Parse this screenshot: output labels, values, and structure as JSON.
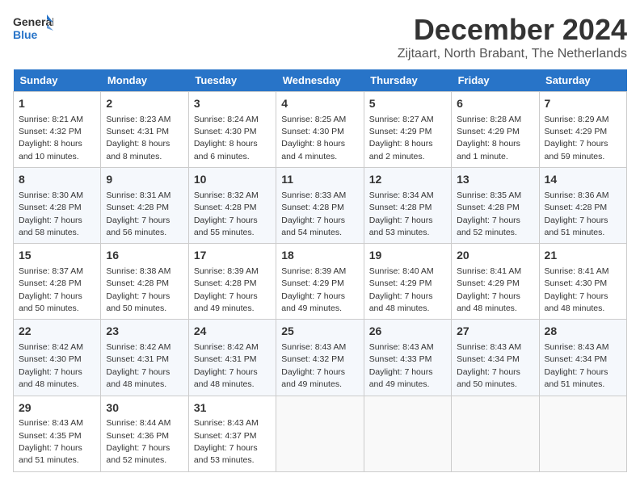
{
  "logo": {
    "line1": "General",
    "line2": "Blue"
  },
  "title": "December 2024",
  "subtitle": "Zijtaart, North Brabant, The Netherlands",
  "days_of_week": [
    "Sunday",
    "Monday",
    "Tuesday",
    "Wednesday",
    "Thursday",
    "Friday",
    "Saturday"
  ],
  "weeks": [
    [
      {
        "day": "1",
        "sunrise": "8:21 AM",
        "sunset": "4:32 PM",
        "daylight": "8 hours and 10 minutes."
      },
      {
        "day": "2",
        "sunrise": "8:23 AM",
        "sunset": "4:31 PM",
        "daylight": "8 hours and 8 minutes."
      },
      {
        "day": "3",
        "sunrise": "8:24 AM",
        "sunset": "4:30 PM",
        "daylight": "8 hours and 6 minutes."
      },
      {
        "day": "4",
        "sunrise": "8:25 AM",
        "sunset": "4:30 PM",
        "daylight": "8 hours and 4 minutes."
      },
      {
        "day": "5",
        "sunrise": "8:27 AM",
        "sunset": "4:29 PM",
        "daylight": "8 hours and 2 minutes."
      },
      {
        "day": "6",
        "sunrise": "8:28 AM",
        "sunset": "4:29 PM",
        "daylight": "8 hours and 1 minute."
      },
      {
        "day": "7",
        "sunrise": "8:29 AM",
        "sunset": "4:29 PM",
        "daylight": "7 hours and 59 minutes."
      }
    ],
    [
      {
        "day": "8",
        "sunrise": "8:30 AM",
        "sunset": "4:28 PM",
        "daylight": "7 hours and 58 minutes."
      },
      {
        "day": "9",
        "sunrise": "8:31 AM",
        "sunset": "4:28 PM",
        "daylight": "7 hours and 56 minutes."
      },
      {
        "day": "10",
        "sunrise": "8:32 AM",
        "sunset": "4:28 PM",
        "daylight": "7 hours and 55 minutes."
      },
      {
        "day": "11",
        "sunrise": "8:33 AM",
        "sunset": "4:28 PM",
        "daylight": "7 hours and 54 minutes."
      },
      {
        "day": "12",
        "sunrise": "8:34 AM",
        "sunset": "4:28 PM",
        "daylight": "7 hours and 53 minutes."
      },
      {
        "day": "13",
        "sunrise": "8:35 AM",
        "sunset": "4:28 PM",
        "daylight": "7 hours and 52 minutes."
      },
      {
        "day": "14",
        "sunrise": "8:36 AM",
        "sunset": "4:28 PM",
        "daylight": "7 hours and 51 minutes."
      }
    ],
    [
      {
        "day": "15",
        "sunrise": "8:37 AM",
        "sunset": "4:28 PM",
        "daylight": "7 hours and 50 minutes."
      },
      {
        "day": "16",
        "sunrise": "8:38 AM",
        "sunset": "4:28 PM",
        "daylight": "7 hours and 50 minutes."
      },
      {
        "day": "17",
        "sunrise": "8:39 AM",
        "sunset": "4:28 PM",
        "daylight": "7 hours and 49 minutes."
      },
      {
        "day": "18",
        "sunrise": "8:39 AM",
        "sunset": "4:29 PM",
        "daylight": "7 hours and 49 minutes."
      },
      {
        "day": "19",
        "sunrise": "8:40 AM",
        "sunset": "4:29 PM",
        "daylight": "7 hours and 48 minutes."
      },
      {
        "day": "20",
        "sunrise": "8:41 AM",
        "sunset": "4:29 PM",
        "daylight": "7 hours and 48 minutes."
      },
      {
        "day": "21",
        "sunrise": "8:41 AM",
        "sunset": "4:30 PM",
        "daylight": "7 hours and 48 minutes."
      }
    ],
    [
      {
        "day": "22",
        "sunrise": "8:42 AM",
        "sunset": "4:30 PM",
        "daylight": "7 hours and 48 minutes."
      },
      {
        "day": "23",
        "sunrise": "8:42 AM",
        "sunset": "4:31 PM",
        "daylight": "7 hours and 48 minutes."
      },
      {
        "day": "24",
        "sunrise": "8:42 AM",
        "sunset": "4:31 PM",
        "daylight": "7 hours and 48 minutes."
      },
      {
        "day": "25",
        "sunrise": "8:43 AM",
        "sunset": "4:32 PM",
        "daylight": "7 hours and 49 minutes."
      },
      {
        "day": "26",
        "sunrise": "8:43 AM",
        "sunset": "4:33 PM",
        "daylight": "7 hours and 49 minutes."
      },
      {
        "day": "27",
        "sunrise": "8:43 AM",
        "sunset": "4:34 PM",
        "daylight": "7 hours and 50 minutes."
      },
      {
        "day": "28",
        "sunrise": "8:43 AM",
        "sunset": "4:34 PM",
        "daylight": "7 hours and 51 minutes."
      }
    ],
    [
      {
        "day": "29",
        "sunrise": "8:43 AM",
        "sunset": "4:35 PM",
        "daylight": "7 hours and 51 minutes."
      },
      {
        "day": "30",
        "sunrise": "8:44 AM",
        "sunset": "4:36 PM",
        "daylight": "7 hours and 52 minutes."
      },
      {
        "day": "31",
        "sunrise": "8:43 AM",
        "sunset": "4:37 PM",
        "daylight": "7 hours and 53 minutes."
      },
      null,
      null,
      null,
      null
    ]
  ]
}
